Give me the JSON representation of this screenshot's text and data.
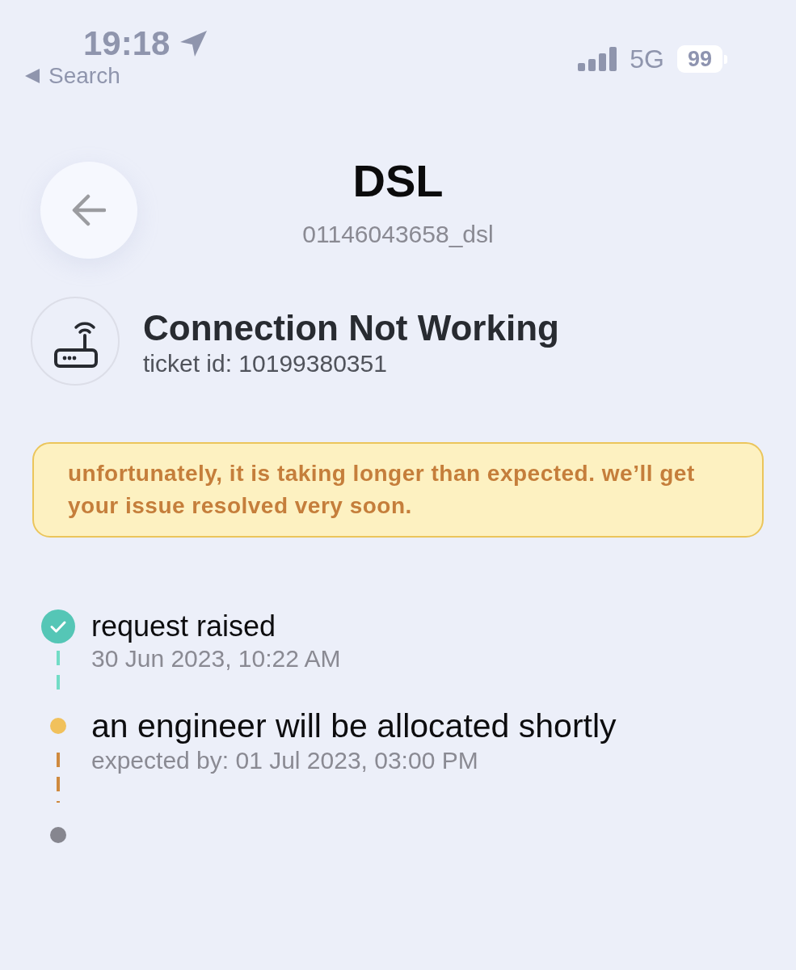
{
  "status_bar": {
    "time": "19:18",
    "back_label": "Search",
    "network": "5G",
    "battery": "99"
  },
  "header": {
    "title": "DSL",
    "subtitle": "01146043658_dsl"
  },
  "ticket": {
    "title": "Connection Not Working",
    "id_line": "ticket id: 10199380351"
  },
  "notice": {
    "message": "unfortunately, it is taking longer than expected. we’ll get your issue resolved very soon."
  },
  "steps": [
    {
      "kind": "done",
      "color": "#55c6b6",
      "title": "request raised",
      "detail": "30 Jun 2023, 10:22 AM"
    },
    {
      "kind": "active",
      "color": "#f1c15c",
      "title": "an engineer will be allocated shortly",
      "detail": "expected by: 01 Jul 2023, 03:00 PM"
    },
    {
      "kind": "pending",
      "color": "#86868f"
    }
  ]
}
